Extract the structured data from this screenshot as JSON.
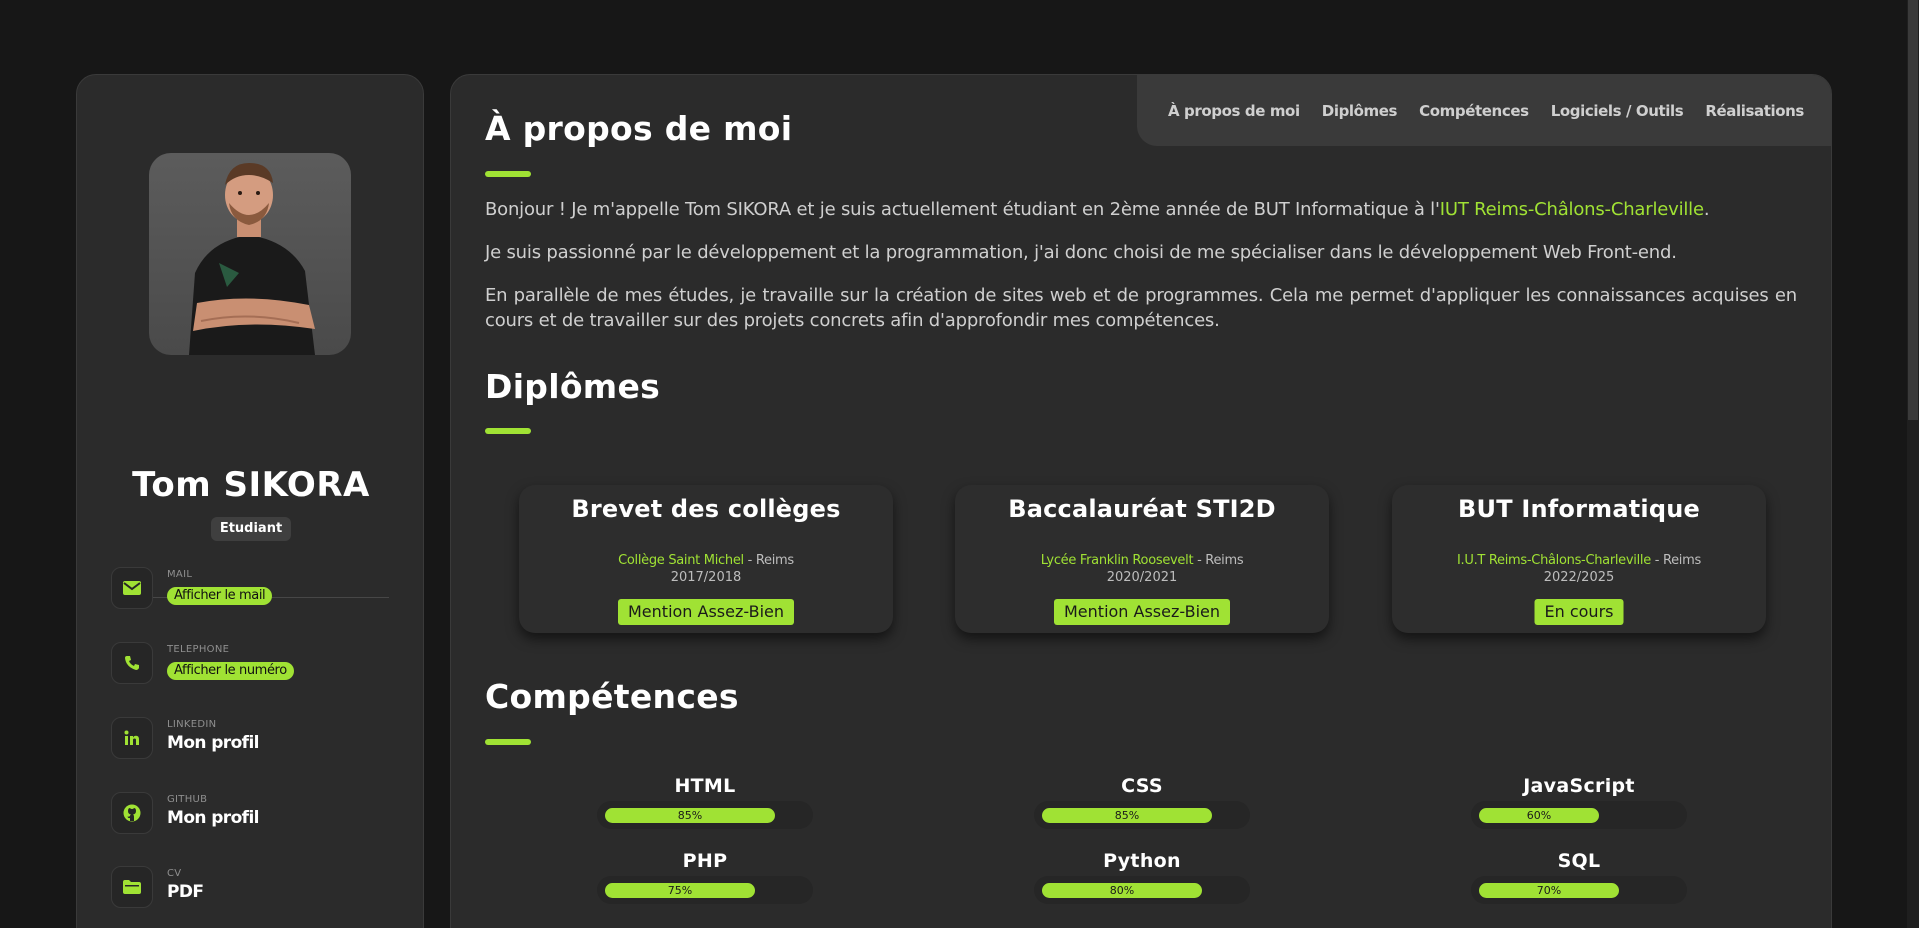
{
  "sidebar": {
    "name": "Tom SIKORA",
    "role": "Etudiant",
    "contacts": [
      {
        "label": "MAIL",
        "value": "Afficher le mail",
        "icon": "mail-icon",
        "style": "pill"
      },
      {
        "label": "TELEPHONE",
        "value": "Afficher le numéro",
        "icon": "phone-icon",
        "style": "pill"
      },
      {
        "label": "LINKEDIN",
        "value": "Mon profil",
        "icon": "linkedin-icon",
        "style": "text"
      },
      {
        "label": "GITHUB",
        "value": "Mon profil",
        "icon": "github-icon",
        "style": "text"
      },
      {
        "label": "CV",
        "value": "PDF",
        "icon": "folder-icon",
        "style": "text"
      }
    ]
  },
  "nav": {
    "items": [
      "À propos de moi",
      "Diplômes",
      "Compétences",
      "Logiciels / Outils",
      "Réalisations"
    ]
  },
  "about": {
    "title": "À propos de moi",
    "p1_before": "Bonjour ! Je m'appelle Tom SIKORA et je suis actuellement étudiant en 2ème année de BUT Informatique à l'",
    "p1_link": "IUT Reims-Châlons-Charleville",
    "p1_after": ".",
    "p2": "Je suis passionné par le développement et la programmation, j'ai donc choisi de me spécialiser dans le développement Web Front-end.",
    "p3": "En parallèle de mes études, je travaille sur la création de sites web et de programmes. Cela me permet d'appliquer les connaissances acquises en cours et de travailler sur des projets concrets afin d'approfondir mes compétences."
  },
  "diplomas": {
    "title": "Diplômes",
    "items": [
      {
        "name": "Brevet des collèges",
        "school": "Collège Saint Michel",
        "city": " - Reims",
        "years": "2017/2018",
        "mention": "Mention Assez-Bien"
      },
      {
        "name": "Baccalauréat STI2D",
        "school": "Lycée Franklin Roosevelt",
        "city": " - Reims",
        "years": "2020/2021",
        "mention": "Mention Assez-Bien"
      },
      {
        "name": "BUT Informatique",
        "school": "I.U.T Reims-Châlons-Charleville",
        "city": " - Reims",
        "years": "2022/2025",
        "mention": "En cours"
      }
    ]
  },
  "skills": {
    "title": "Compétences",
    "items": [
      {
        "name": "HTML",
        "percent": 85,
        "label": "85%"
      },
      {
        "name": "CSS",
        "percent": 85,
        "label": "85%"
      },
      {
        "name": "JavaScript",
        "percent": 60,
        "label": "60%"
      },
      {
        "name": "PHP",
        "percent": 75,
        "label": "75%"
      },
      {
        "name": "Python",
        "percent": 80,
        "label": "80%"
      },
      {
        "name": "SQL",
        "percent": 70,
        "label": "70%"
      }
    ]
  },
  "colors": {
    "accent": "#a0e234",
    "background": "#171717",
    "card": "#2b2b2b"
  }
}
